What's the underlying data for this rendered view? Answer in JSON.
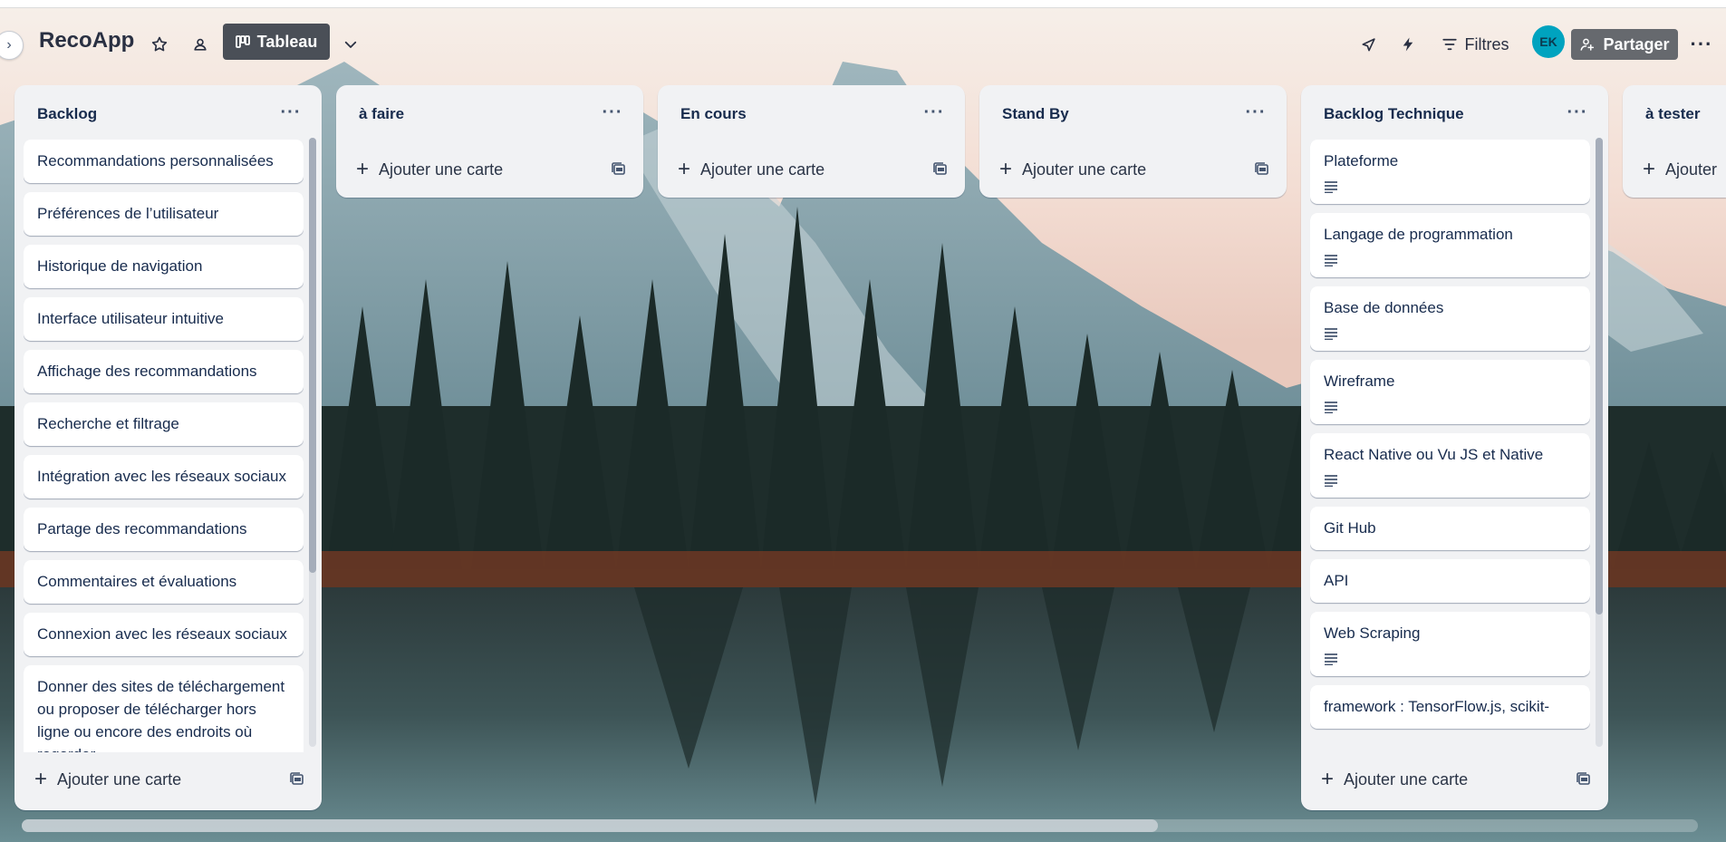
{
  "board": {
    "title": "RecoApp",
    "view_label": "Tableau",
    "filters_label": "Filtres",
    "share_label": "Partager",
    "avatar_initials": "EK",
    "accent_color": "#4a4f57"
  },
  "icons": {
    "sidebar_toggle": "chevron-right-icon",
    "star": "star-icon",
    "workspace": "workspace-visibility-icon",
    "view": "board-icon",
    "view_menu": "chevron-down-icon",
    "power_ups": "rocket-icon",
    "automation": "bolt-icon",
    "filters": "filter-icon",
    "share": "add-member-icon",
    "more": "ellipsis-icon",
    "list_menu": "ellipsis-icon",
    "add_card": "plus-icon",
    "template": "card-template-icon",
    "description": "description-icon"
  },
  "lists": [
    {
      "title": "Backlog",
      "add_label": "Ajouter une carte",
      "cards": [
        {
          "text": "Recommandations personnalisées",
          "has_description": false
        },
        {
          "text": "Préférences de l’utilisateur",
          "has_description": false
        },
        {
          "text": "Historique de navigation",
          "has_description": false
        },
        {
          "text": "Interface utilisateur intuitive",
          "has_description": false
        },
        {
          "text": "Affichage des recommandations",
          "has_description": false
        },
        {
          "text": "Recherche et filtrage",
          "has_description": false
        },
        {
          "text": "Intégration avec les réseaux sociaux",
          "has_description": false
        },
        {
          "text": "Partage des recommandations",
          "has_description": false
        },
        {
          "text": "Commentaires et évaluations",
          "has_description": false
        },
        {
          "text": "Connexion avec les réseaux sociaux",
          "has_description": false
        },
        {
          "text": "Donner des sites de téléchargement ou proposer de télécharger hors ligne ou encore des endroits où regarder",
          "has_description": false
        }
      ]
    },
    {
      "title": "à faire",
      "add_label": "Ajouter une carte",
      "cards": []
    },
    {
      "title": "En cours",
      "add_label": "Ajouter une carte",
      "cards": []
    },
    {
      "title": "Stand By",
      "add_label": "Ajouter une carte",
      "cards": []
    },
    {
      "title": "Backlog Technique",
      "add_label": "Ajouter une carte",
      "cards": [
        {
          "text": "Plateforme",
          "has_description": true
        },
        {
          "text": "Langage de programmation",
          "has_description": true
        },
        {
          "text": "Base de données",
          "has_description": true
        },
        {
          "text": "Wireframe",
          "has_description": true
        },
        {
          "text": "React Native ou Vu JS et Native",
          "has_description": true
        },
        {
          "text": "Git Hub",
          "has_description": false
        },
        {
          "text": "API",
          "has_description": false
        },
        {
          "text": "Web Scraping",
          "has_description": true
        },
        {
          "text": "framework : TensorFlow.js, scikit-",
          "has_description": false
        }
      ]
    },
    {
      "title": "à tester",
      "add_label": "Ajouter",
      "cards": []
    }
  ]
}
